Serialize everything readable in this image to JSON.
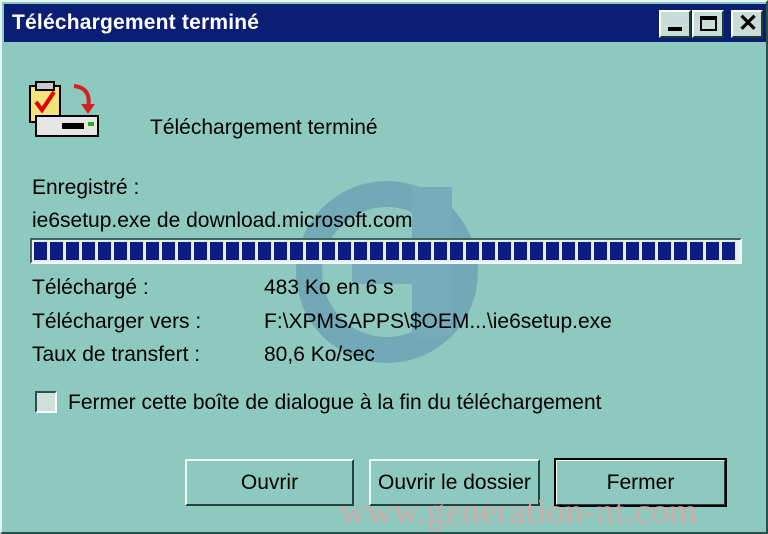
{
  "window": {
    "title": "Téléchargement terminé"
  },
  "titlebar_buttons": {
    "minimize_icon": "minimize-icon",
    "maximize_icon": "maximize-icon",
    "close_icon": "close-icon",
    "close_glyph": "✕"
  },
  "header": {
    "title": "Téléchargement terminé",
    "icon": "download-complete-icon"
  },
  "saved": {
    "label": "Enregistré :",
    "value": "ie6setup.exe de download.microsoft.com"
  },
  "progress": {
    "fraction": 1.0
  },
  "details": {
    "downloaded_label": "Téléchargé :",
    "downloaded_value": "483 Ko en 6 s",
    "destination_label": "Télécharger vers :",
    "destination_value": "F:\\XPMSAPPS\\$OEM...\\ie6setup.exe",
    "rate_label": "Taux de transfert :",
    "rate_value": "80,6 Ko/sec"
  },
  "close_on_complete": {
    "label": "Fermer cette boîte de dialogue à la fin du téléchargement",
    "checked": false
  },
  "buttons": {
    "open": "Ouvrir",
    "open_folder": "Ouvrir le dossier",
    "close": "Fermer"
  },
  "watermark": {
    "text": "www.generation-nt.com"
  },
  "colors": {
    "titlebar": "#0a1e73",
    "dialog_bg": "#8ec9bf",
    "progress_fill": "#0b1c82"
  }
}
